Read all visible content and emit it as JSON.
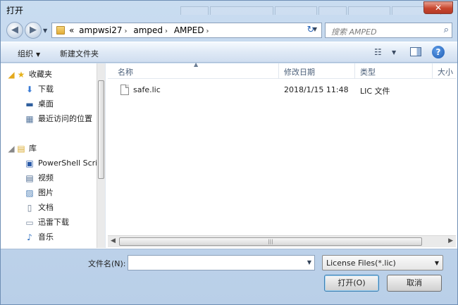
{
  "window": {
    "title": "打开",
    "close_symbol": "✕"
  },
  "address": {
    "overflow": "«",
    "crumbs": [
      "ampwsi27",
      "amped",
      "AMPED"
    ],
    "separator": "›"
  },
  "search": {
    "placeholder": "搜索 AMPED"
  },
  "toolbar": {
    "organize": "组织",
    "new_folder": "新建文件夹",
    "help": "?"
  },
  "nav": {
    "favorites": {
      "label": "收藏夹",
      "items": [
        "下载",
        "桌面",
        "最近访问的位置"
      ]
    },
    "libraries": {
      "label": "库",
      "items": [
        "PowerShell Scri",
        "视频",
        "图片",
        "文档",
        "迅雷下载",
        "音乐"
      ]
    }
  },
  "columns": {
    "name": "名称",
    "modified": "修改日期",
    "type": "类型",
    "size": "大小"
  },
  "files": [
    {
      "name": "safe.lic",
      "modified": "2018/1/15 11:48",
      "type": "LIC 文件"
    }
  ],
  "bottom": {
    "filename_label": "文件名(N):",
    "filename_value": "",
    "filetype": "License Files(*.lic)",
    "open_label": "打开(O)",
    "cancel_label": "取消"
  }
}
